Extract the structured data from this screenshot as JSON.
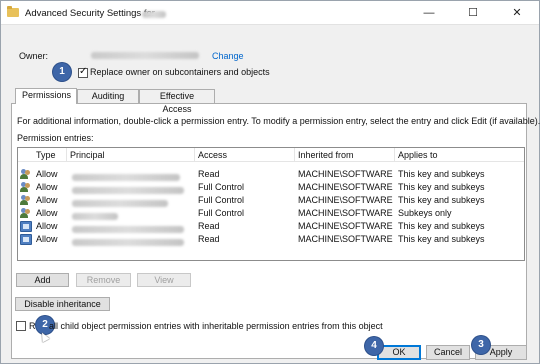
{
  "window": {
    "title": "Advanced Security Settings for",
    "minimize": "—",
    "maximize": "☐",
    "close": "✕"
  },
  "owner": {
    "label": "Owner:",
    "change_link": "Change"
  },
  "replace_owner": {
    "label": "Replace owner on subcontainers and objects",
    "checked": true
  },
  "tabs": [
    {
      "label": "Permissions",
      "active": true
    },
    {
      "label": "Auditing",
      "active": false
    },
    {
      "label": "Effective Access",
      "active": false
    }
  ],
  "info_text": "For additional information, double-click a permission entry. To modify a permission entry, select the entry and click Edit (if available).",
  "entries_label": "Permission entries:",
  "table": {
    "headers": [
      "Type",
      "Principal",
      "Access",
      "Inherited from",
      "Applies to"
    ],
    "rows": [
      {
        "icon": "users-icon",
        "type": "Allow",
        "access": "Read",
        "inherited": "MACHINE\\SOFTWARE",
        "applies": "This key and subkeys"
      },
      {
        "icon": "users-icon",
        "type": "Allow",
        "access": "Full Control",
        "inherited": "MACHINE\\SOFTWARE",
        "applies": "This key and subkeys"
      },
      {
        "icon": "users-icon",
        "type": "Allow",
        "access": "Full Control",
        "inherited": "MACHINE\\SOFTWARE",
        "applies": "This key and subkeys"
      },
      {
        "icon": "users-icon",
        "type": "Allow",
        "access": "Full Control",
        "inherited": "MACHINE\\SOFTWARE",
        "applies": "Subkeys only"
      },
      {
        "icon": "app-package-icon",
        "type": "Allow",
        "access": "Read",
        "inherited": "MACHINE\\SOFTWARE",
        "applies": "This key and subkeys"
      },
      {
        "icon": "app-package-icon",
        "type": "Allow",
        "access": "Read",
        "inherited": "MACHINE\\SOFTWARE",
        "applies": "This key and subkeys"
      }
    ]
  },
  "buttons": {
    "add": "Add",
    "remove": "Remove",
    "view": "View",
    "disable_inheritance": "Disable inheritance",
    "ok": "OK",
    "cancel": "Cancel",
    "apply": "Apply"
  },
  "replace_child": {
    "label_start": "Re",
    "label_rest": "all child object permission entries with inheritable permission entries from this object",
    "checked": false
  },
  "badges": [
    "1",
    "2",
    "3",
    "4"
  ],
  "colors": {
    "badge": "#3e66a8",
    "link": "#0066cc",
    "default_button_border": "#0078d7"
  }
}
